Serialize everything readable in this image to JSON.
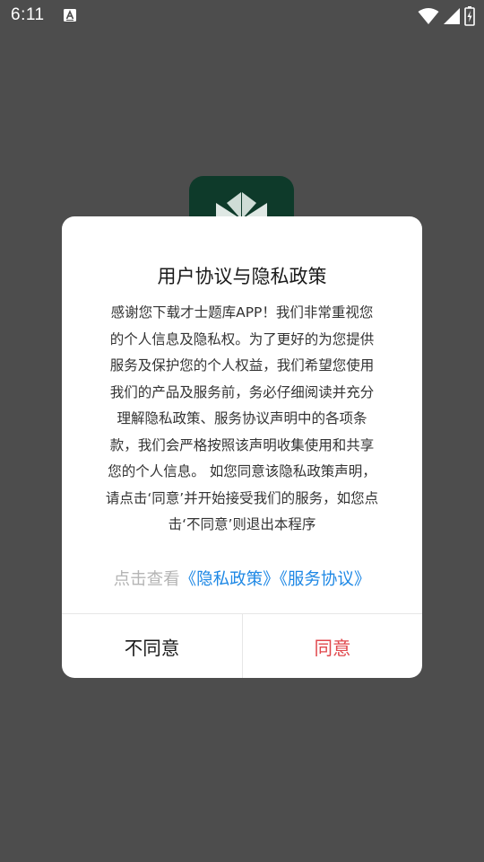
{
  "status_bar": {
    "time": "6:11",
    "notification_icon": "accessibility-a-icon",
    "right_icons": [
      "wifi-icon",
      "cellular-signal-icon",
      "battery-icon"
    ]
  },
  "background_app": {
    "icon": "app-logo-icon",
    "icon_color": "#0e3a2a"
  },
  "dialog": {
    "title": "用户协议与隐私政策",
    "body_lines": [
      "感谢您下载才士题库APP！我们非常重视您",
      "的个人信息及隐私权。为了更好的为您提供",
      "服务及保护您的个人权益，我们希望您使用",
      "我们的产品及服务前，务必仔细阅读并充分",
      "理解隐私政策、服务协议声明中的各项条",
      "款，我们会严格按照该声明收集使用和共享",
      "您的个人信息。 如您同意该隐私政策声明，",
      "请点击‘同意’并开始接受我们的服务，如您点",
      "击‘不同意’则退出本程序"
    ],
    "links_prefix": "点击查看",
    "privacy_link": "《隐私政策》",
    "service_link": "《服务协议》",
    "disagree_label": "不同意",
    "agree_label": "同意",
    "colors": {
      "link": "#1e88e5",
      "agree": "#e0474c",
      "prefix": "#b5b5b5"
    }
  }
}
